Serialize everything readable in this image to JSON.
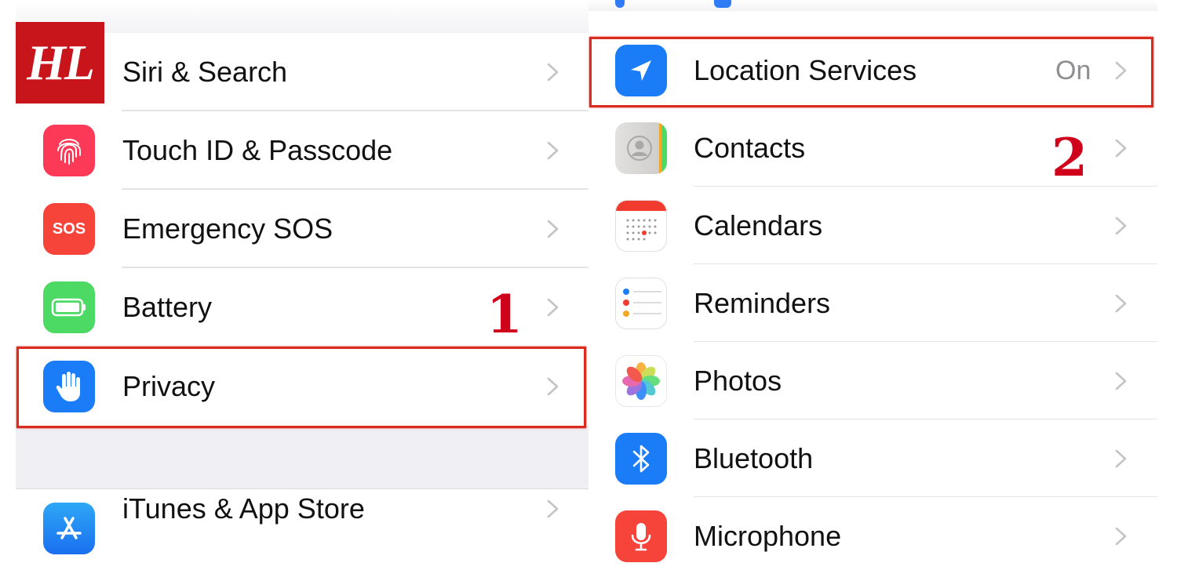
{
  "logo": {
    "text": "HL"
  },
  "left_settings": {
    "items": [
      {
        "label": "Siri & Search",
        "icon": "siri-icon"
      },
      {
        "label": "Touch ID & Passcode",
        "icon": "fingerprint-icon",
        "color": "#fc3a58"
      },
      {
        "label": "Emergency SOS",
        "icon": "sos-icon",
        "icon_text": "SOS",
        "color": "#f6443a"
      },
      {
        "label": "Battery",
        "icon": "battery-icon",
        "color": "#4cd964"
      },
      {
        "label": "Privacy",
        "icon": "hand-icon",
        "color": "#1a7cf7"
      },
      {
        "label": "iTunes & App Store",
        "icon": "app-store-icon",
        "color": "#2196f3"
      }
    ]
  },
  "privacy_menu": {
    "items": [
      {
        "label": "Location Services",
        "value": "On",
        "icon": "location-arrow-icon",
        "color": "#1a7cf7"
      },
      {
        "label": "Contacts",
        "icon": "contacts-icon",
        "color": "#c9c8c8"
      },
      {
        "label": "Calendars",
        "icon": "calendar-icon",
        "color": "#f03b2e"
      },
      {
        "label": "Reminders",
        "icon": "reminders-icon"
      },
      {
        "label": "Photos",
        "icon": "photos-icon"
      },
      {
        "label": "Bluetooth",
        "icon": "bluetooth-icon",
        "color": "#1a7cf7"
      },
      {
        "label": "Microphone",
        "icon": "microphone-icon",
        "color": "#f6443a"
      }
    ]
  },
  "annotations": {
    "step1": "1",
    "step2": "2",
    "highlight_color": "#d92b20"
  }
}
